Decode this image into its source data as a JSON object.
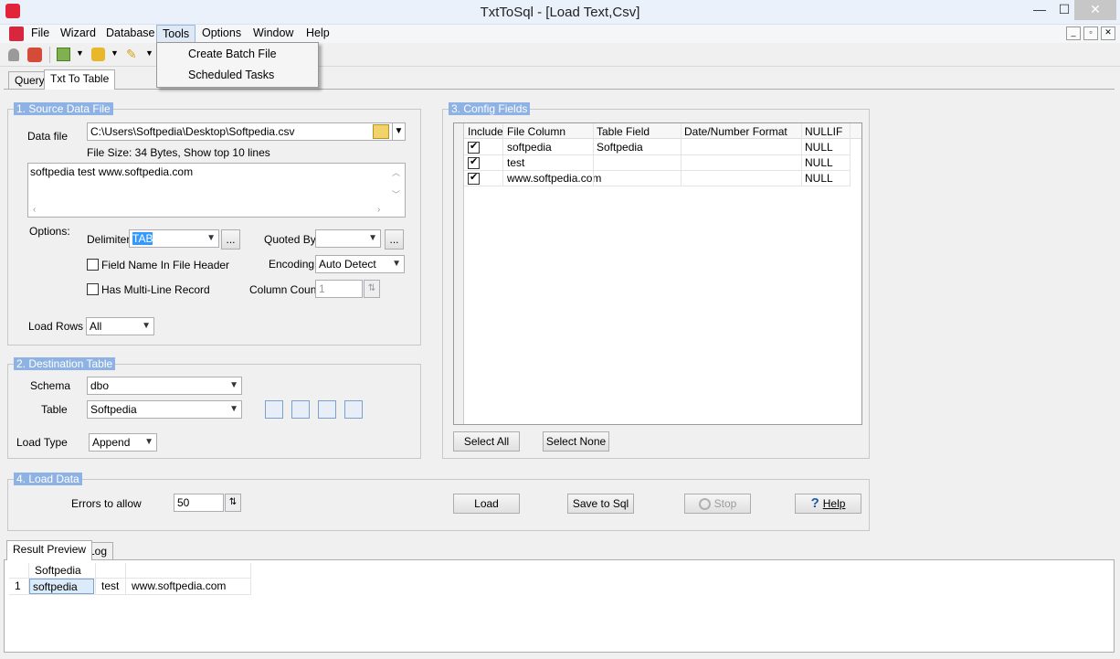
{
  "window": {
    "title": "TxtToSql - [Load Text,Csv]",
    "minimize": "—",
    "maximize": "☐",
    "close": "✕"
  },
  "menu": {
    "items": [
      "File",
      "Wizard",
      "Database",
      "Tools",
      "Options",
      "Window",
      "Help"
    ],
    "tools_dropdown": [
      "Create Batch File",
      "Scheduled Tasks"
    ]
  },
  "tabs": {
    "top": [
      "Query",
      "Txt To Table"
    ],
    "bottom": [
      "Result Preview",
      "Log"
    ]
  },
  "source": {
    "legend": "1. Source Data File",
    "data_file_label": "Data file",
    "data_file_value": "C:\\Users\\Softpedia\\Desktop\\Softpedia.csv",
    "file_info": "File Size: 34 Bytes,  Show top 10 lines",
    "preview_text": "softpedia  test         www.softpedia.com",
    "options_label": "Options:",
    "delimiter_label": "Delimiter",
    "delimiter_value": "TAB",
    "ellipsis": "...",
    "quoted_by_label": "Quoted By",
    "quoted_by_value": "",
    "field_name_header_label": "Field Name In File Header",
    "encoding_label": "Encoding",
    "encoding_value": "Auto Detect",
    "multiline_label": "Has Multi-Line Record",
    "column_count_label": "Column Count",
    "column_count_value": "1",
    "load_rows_label": "Load Rows",
    "load_rows_value": "All"
  },
  "destination": {
    "legend": "2. Destination Table",
    "schema_label": "Schema",
    "schema_value": "dbo",
    "table_label": "Table",
    "table_value": "Softpedia",
    "load_type_label": "Load Type",
    "load_type_value": "Append"
  },
  "config": {
    "legend": "3. Config Fields",
    "columns": [
      "Include",
      "File Column",
      "Table Field",
      "Date/Number Format",
      "NULLIF"
    ],
    "rows": [
      {
        "include": true,
        "file_column": "softpedia",
        "table_field": "Softpedia",
        "format": "",
        "nullif": "NULL"
      },
      {
        "include": true,
        "file_column": "test",
        "table_field": "",
        "format": "",
        "nullif": "NULL"
      },
      {
        "include": true,
        "file_column": "www.softpedia.com",
        "table_field": "",
        "format": "",
        "nullif": "NULL"
      }
    ],
    "select_all": "Select All",
    "select_none": "Select None"
  },
  "load": {
    "legend": "4. Load Data",
    "errors_label": "Errors to allow",
    "errors_value": "50",
    "load_button": "Load",
    "save_button": "Save to Sql",
    "stop_button": "Stop",
    "help_button": "Help"
  },
  "result": {
    "header": [
      "Softpedia",
      "",
      ""
    ],
    "rows": [
      {
        "num": "1",
        "c1": "softpedia",
        "c2": "test",
        "c3": "www.softpedia.com"
      }
    ]
  },
  "colors": {
    "legend_bg": "#8db2e3",
    "titlebar_bg": "#eaf1fb",
    "selection": "#3399ff"
  }
}
